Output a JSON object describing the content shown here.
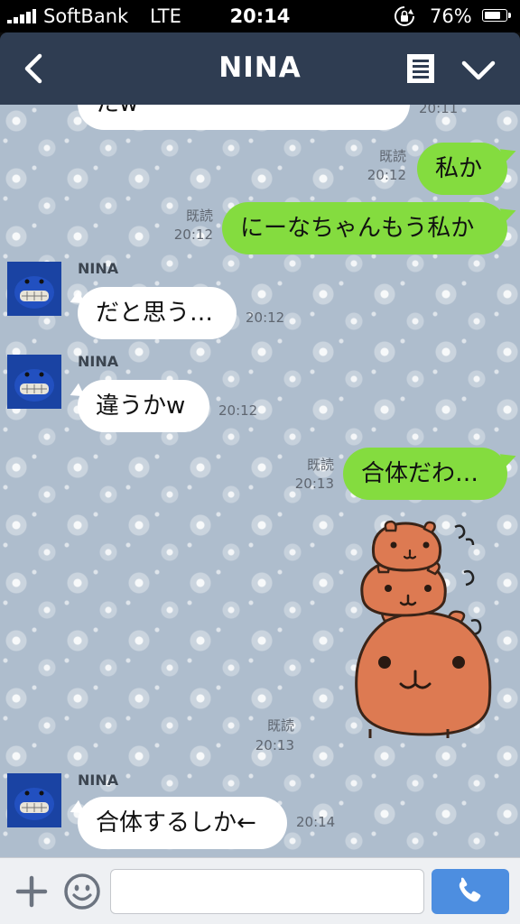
{
  "status_bar": {
    "carrier": "SoftBank",
    "network": "LTE",
    "time": "20:14",
    "battery_percent": "76%",
    "battery_level": 0.76
  },
  "header": {
    "title": "NINA",
    "back_icon": "chevron-left-icon",
    "note_icon": "notes-icon",
    "menu_icon": "chevron-down-icon"
  },
  "messages": [
    {
      "type": "in",
      "text": "たw",
      "time": "20:11"
    },
    {
      "type": "out",
      "read": "既読",
      "time": "20:12",
      "text": "私か"
    },
    {
      "type": "out",
      "read": "既読",
      "time": "20:12",
      "text": "にーなちゃんもう私か"
    },
    {
      "type": "in",
      "sender": "NINA",
      "text": "だと思う…",
      "time": "20:12"
    },
    {
      "type": "in",
      "sender": "NINA",
      "text": "違うかw",
      "time": "20:12"
    },
    {
      "type": "out",
      "read": "既読",
      "time": "20:13",
      "text": "合体だわ…"
    },
    {
      "type": "sticker",
      "read": "既読",
      "time": "20:13",
      "sticker": "capybara-stack-sticker"
    },
    {
      "type": "in",
      "sender": "NINA",
      "text": "合体するしか←",
      "time": "20:14"
    }
  ],
  "input_bar": {
    "placeholder": "",
    "value": ""
  },
  "colors": {
    "header_bg": "#2f3d52",
    "out_bubble": "#84dc3f",
    "in_bubble": "#ffffff",
    "call_button": "#4d8ee0",
    "avatar_bg": "#1a43a3",
    "capybara": "#dd7a52"
  }
}
